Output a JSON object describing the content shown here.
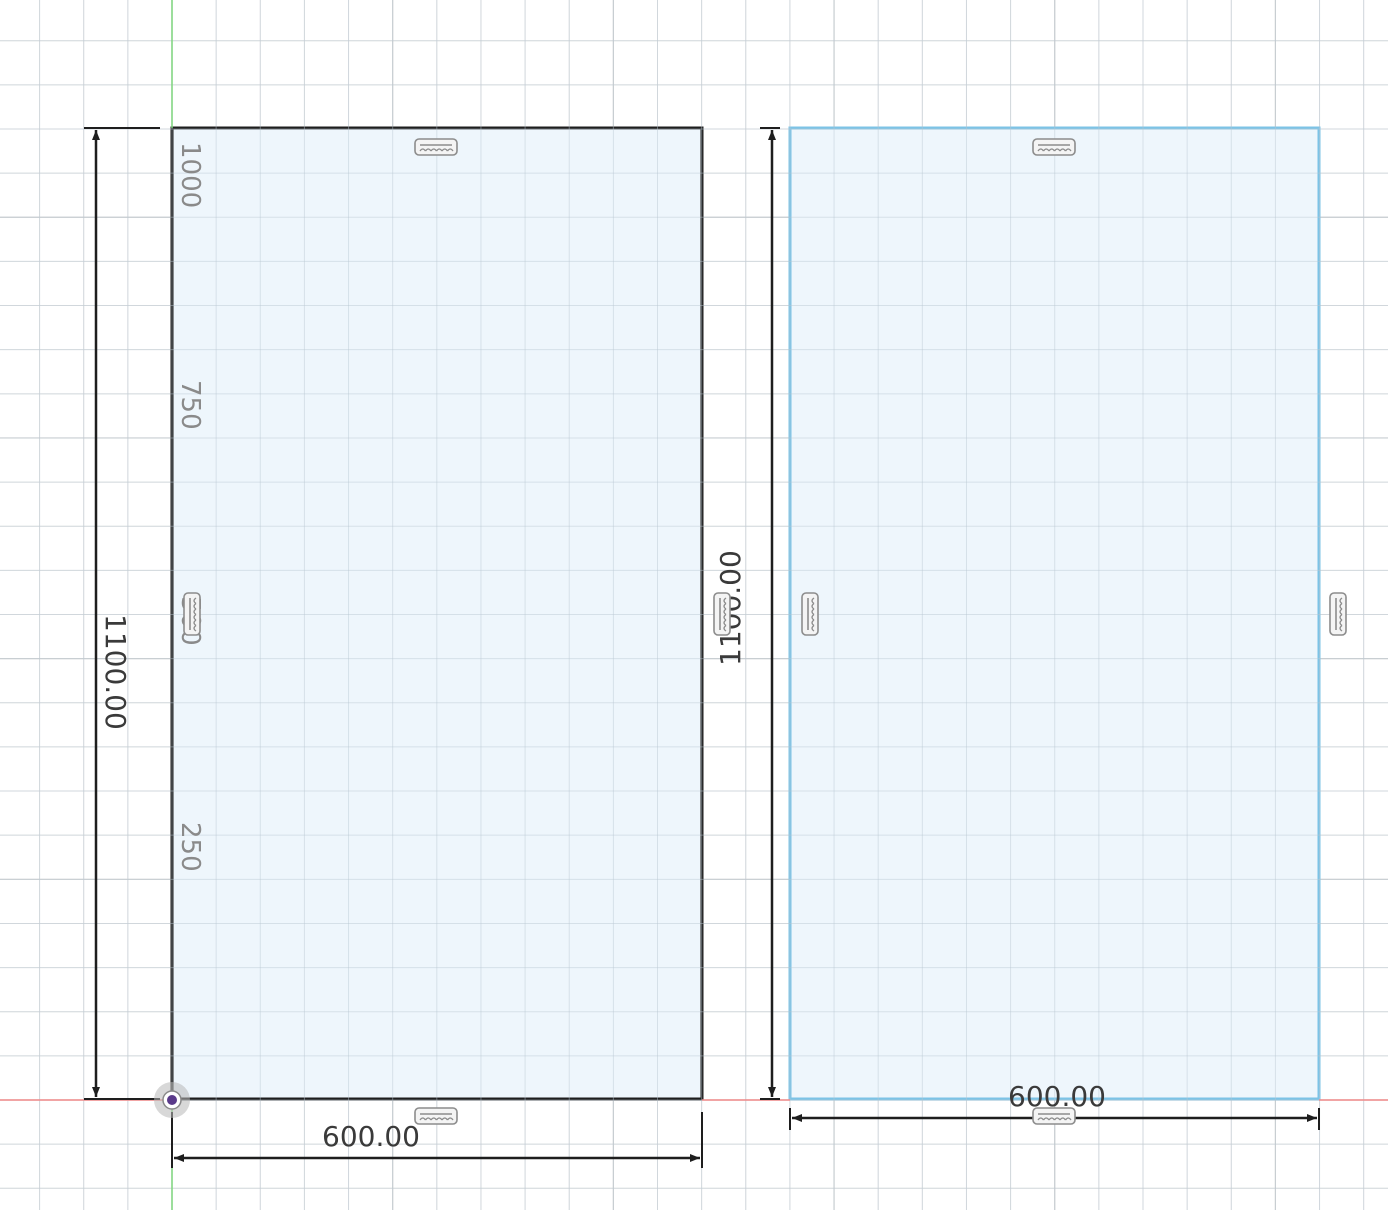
{
  "canvas": {
    "background": "#ffffff",
    "grid_minor_color": "#e6e6e6",
    "grid_major_color": "#d2d2d2",
    "x_axis_color": "#f08a8a",
    "y_axis_color": "#7fd67f"
  },
  "origin": {
    "icon": "origin-point-icon",
    "color": "#5a3a8a"
  },
  "ruler": {
    "labels": [
      "1000",
      "750",
      "500",
      "250"
    ]
  },
  "sketch_left": {
    "fill": "#eef6fc",
    "stroke": "#1e1e1e",
    "width_dim": "600.00",
    "height_dim": "1100.00",
    "constraint_icon": "horizontal-vertical-constraint-icon"
  },
  "sketch_right": {
    "fill": "#eef6fc",
    "stroke": "#7cc3e6",
    "selected": true,
    "width_dim": "600.00",
    "height_dim": "1100.00",
    "constraint_icon": "horizontal-vertical-constraint-icon"
  }
}
